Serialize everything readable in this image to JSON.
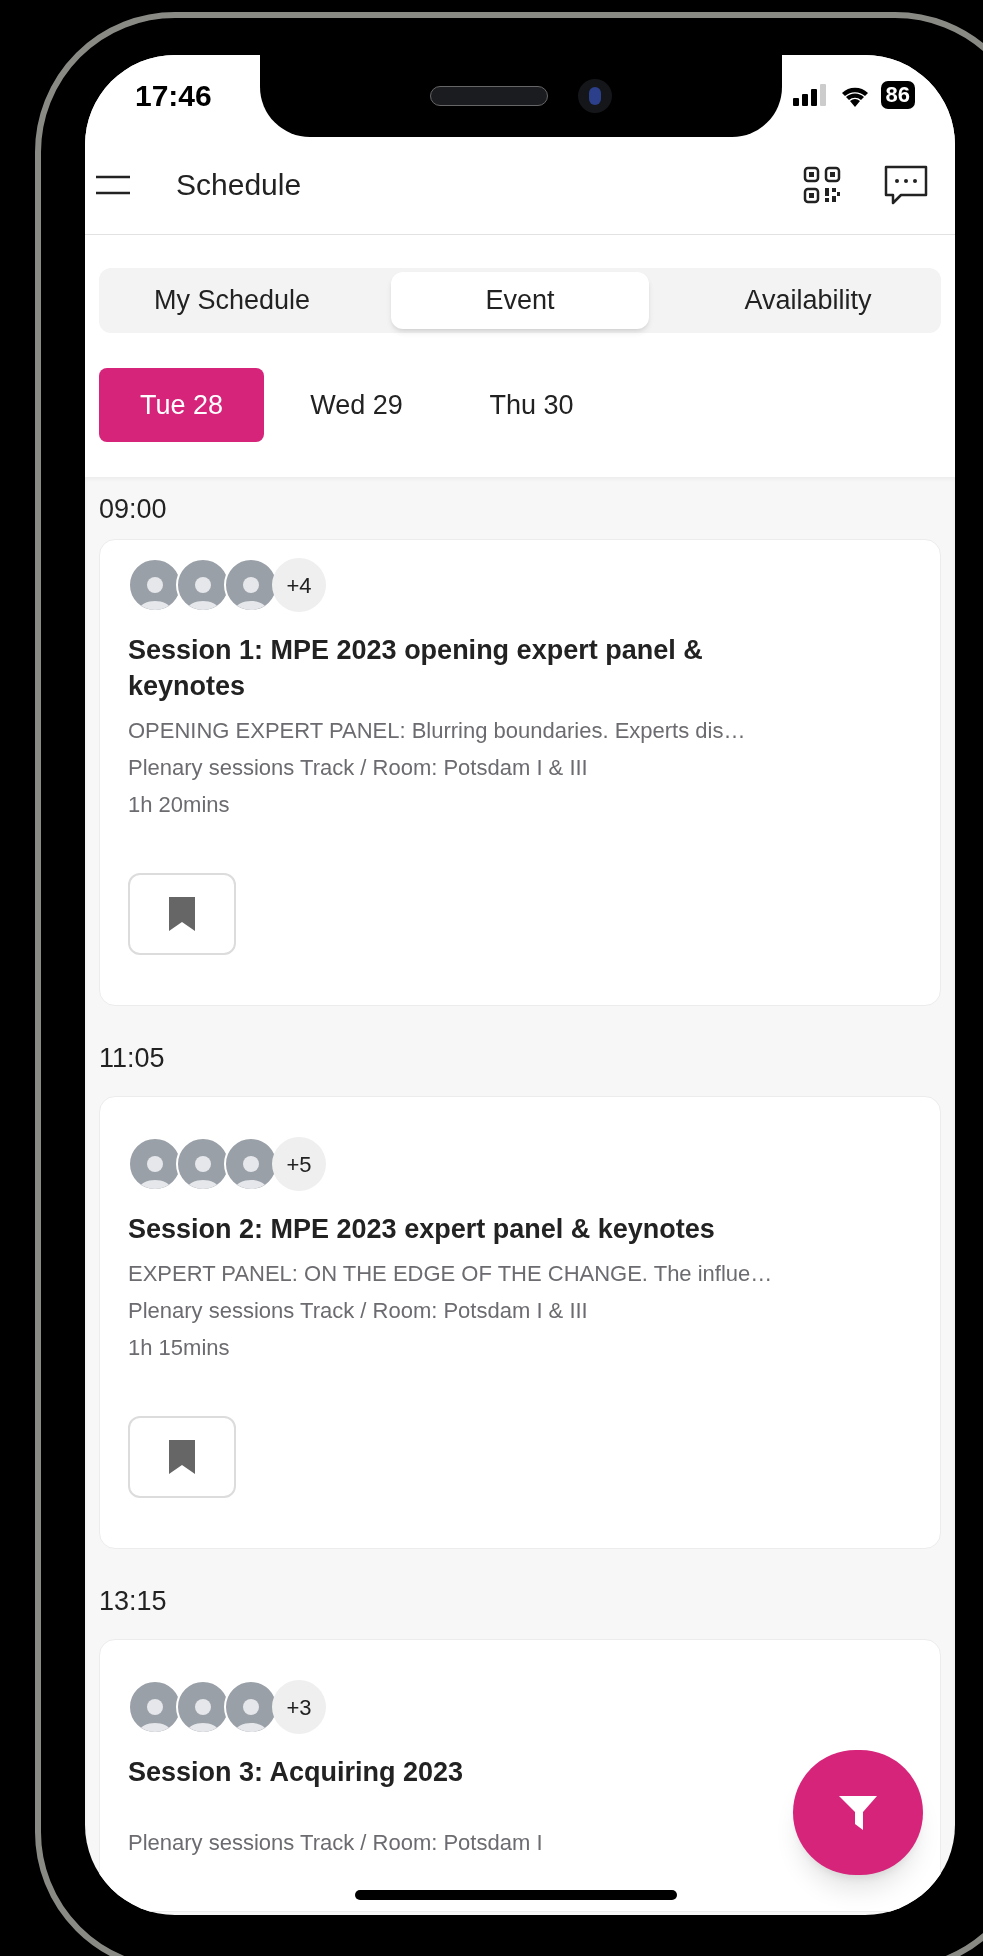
{
  "status_bar": {
    "time": "17:46",
    "battery": "86"
  },
  "header": {
    "title": "Schedule"
  },
  "tabs": [
    {
      "label": "My Schedule",
      "selected": false
    },
    {
      "label": "Event",
      "selected": true
    },
    {
      "label": "Availability",
      "selected": false
    }
  ],
  "days": [
    {
      "label": "Tue 28",
      "selected": true
    },
    {
      "label": "Wed 29",
      "selected": false
    },
    {
      "label": "Thu 30",
      "selected": false
    }
  ],
  "sessions": [
    {
      "time": "09:00",
      "speakers_more": "+4",
      "title": "Session 1: MPE 2023 opening expert panel & keynotes",
      "description": "OPENING EXPERT PANEL: Blurring boundaries. Experts dis…",
      "track": "Plenary sessions Track / Room: Potsdam I & III",
      "duration": "1h 20mins"
    },
    {
      "time": "11:05",
      "speakers_more": "+5",
      "title": "Session 2:  MPE 2023 expert panel & keynotes",
      "description": "EXPERT PANEL: ON THE EDGE OF THE CHANGE. The influe…",
      "track": "Plenary sessions Track / Room: Potsdam I & III",
      "duration": "1h 15mins"
    },
    {
      "time": "13:15",
      "speakers_more": "+3",
      "title": "Session 3: Acquiring 2023",
      "track": "Plenary sessions Track / Room: Potsdam I"
    }
  ]
}
